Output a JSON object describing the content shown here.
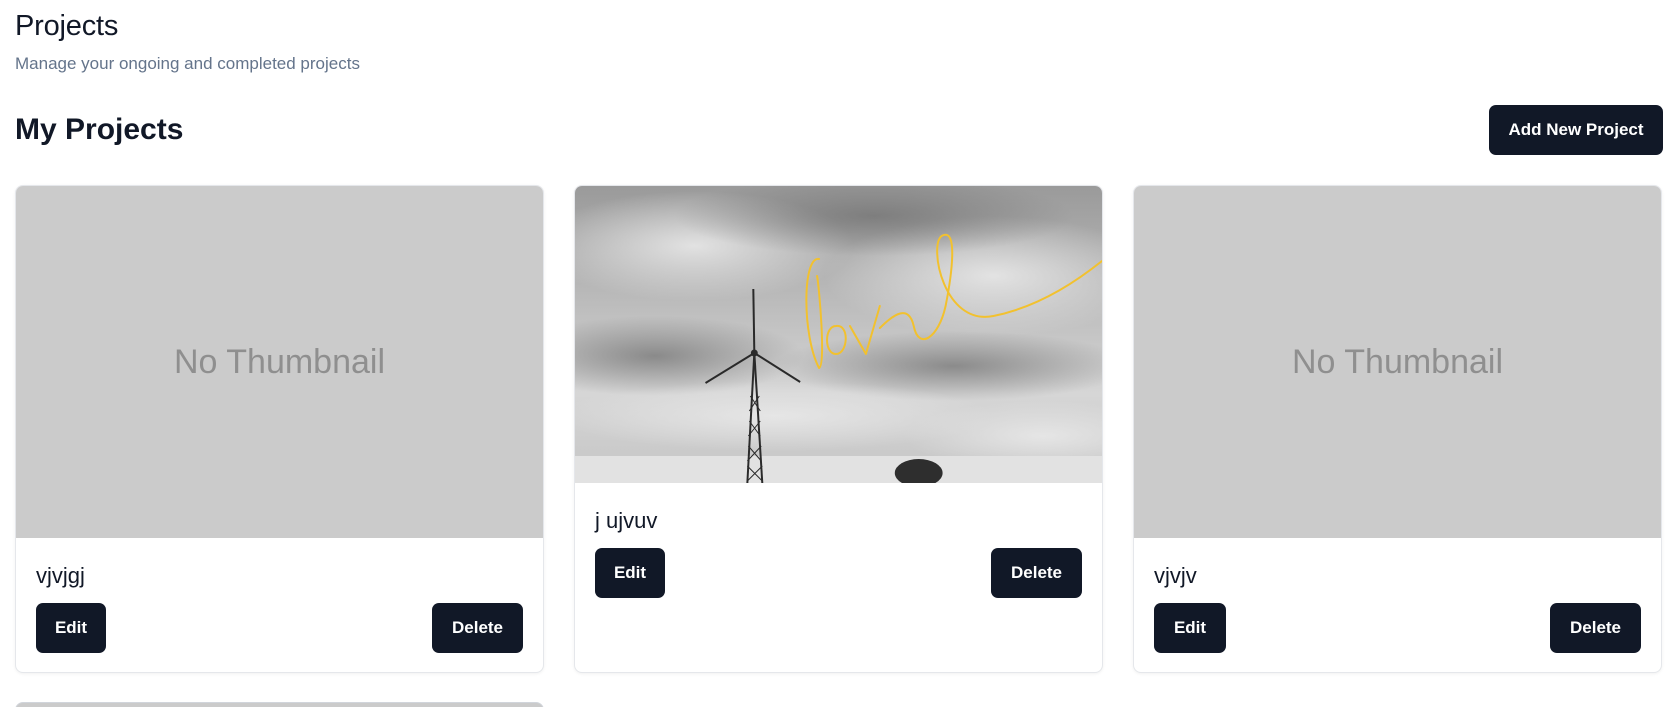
{
  "header": {
    "title": "Projects",
    "subtitle": "Manage your ongoing and completed projects"
  },
  "section": {
    "title": "My Projects",
    "add_button_label": "Add New Project"
  },
  "projects": [
    {
      "name": "vjvjgj",
      "thumbnail": "none",
      "thumbnail_text": "No Thumbnail",
      "edit_label": "Edit",
      "delete_label": "Delete"
    },
    {
      "name": "j ujvuv",
      "thumbnail": "wind-turbine-photo",
      "edit_label": "Edit",
      "delete_label": "Delete"
    },
    {
      "name": "vjvjv",
      "thumbnail": "none",
      "thumbnail_text": "No Thumbnail",
      "edit_label": "Edit",
      "delete_label": "Delete"
    }
  ],
  "colors": {
    "primary_button": "#111827",
    "placeholder_bg": "#cbcbcb",
    "subtitle_text": "#64748b",
    "love_script": "#f2c12e"
  }
}
